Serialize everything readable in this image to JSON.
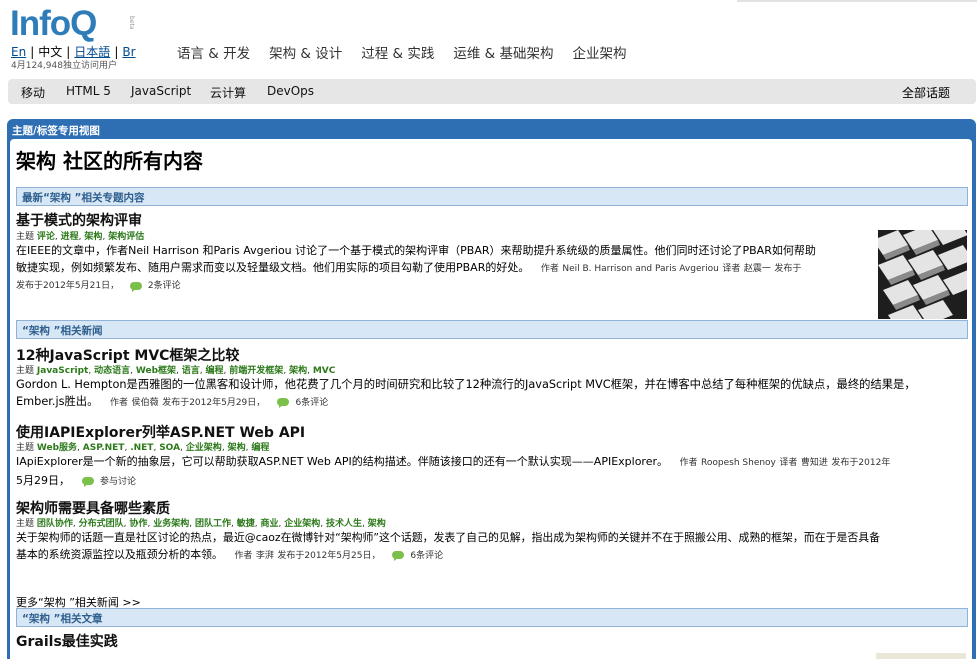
{
  "header": {
    "logo": "InfoQ",
    "logo_badge": "beta",
    "languages": [
      {
        "label": "En",
        "current": false
      },
      {
        "label": "中文",
        "current": true
      },
      {
        "label": "日本語",
        "current": false
      },
      {
        "label": "Br",
        "current": false
      }
    ],
    "visitors": "4月124,948独立访问用户",
    "main_nav": [
      "语言 & 开发",
      "架构 & 设计",
      "过程 & 实践",
      "运维 & 基础架构",
      "企业架构"
    ],
    "sub_nav": [
      "移动",
      "HTML 5",
      "JavaScript",
      "云计算",
      "DevOps"
    ],
    "all_topics": "全部话题"
  },
  "panel": {
    "title": "主题/标签专用视图",
    "page_title": "架构 社区的所有内容"
  },
  "sections": {
    "featured": "最新“架构 ”相关专题内容",
    "news": "“架构 ”相关新闻",
    "articles": "“架构 ”相关文章"
  },
  "featured_item": {
    "title": "基于模式的架构评审",
    "tag_prefix": "主题",
    "tags": [
      "评论",
      "进程",
      "架构",
      "架构评估"
    ],
    "desc_line1": "在IEEE的文章中，作者Neil Harrison 和Paris Avgeriou 讨论了一个基于模式的架构评审（PBAR）来帮助提升系统级的质量属性。他们同时还讨论了PBAR如何帮助",
    "desc_line2": "敏捷实现，例如频繁发布、随用户需求而变以及轻量级文档。他们用实际的项目勾勒了使用PBAR的好处。",
    "author_label": "作者",
    "author": "Neil B. Harrison and Paris Avgeriou",
    "translator_label": "译者",
    "translator": "赵震一",
    "published": "发布于2012年5月21日，",
    "comments": "2条评论",
    "thumb_icon": "architecture-pattern-photo"
  },
  "news": [
    {
      "title": "12种JavaScript MVC框架之比较",
      "tags": [
        "JavaScript",
        "动态语言",
        "Web框架",
        "语言",
        "编程",
        "前端开发框架",
        "架构",
        "MVC"
      ],
      "desc_line1": "Gordon L. Hempton是西雅图的一位黑客和设计师，他花费了几个月的时间研究和比较了12种流行的JavaScript MVC框架，并在博客中总结了每种框架的优缺点，最终的结果是，",
      "desc_line2": "Ember.js胜出。",
      "author": "侯伯薇",
      "published": "发布于2012年5月29日，",
      "comments": "6条评论"
    },
    {
      "title": "使用IAPIExplorer列举ASP.NET Web API",
      "tags": [
        "Web服务",
        "ASP.NET",
        ".NET",
        "SOA",
        "企业架构",
        "架构",
        "编程"
      ],
      "desc_line1": "IApiExplorer是一个新的抽象层，它可以帮助获取ASP.NET Web API的结构描述。伴随该接口的还有一个默认实现——APIExplorer。",
      "desc_line2": "5月29日，",
      "author": "Roopesh Shenoy",
      "translator": "曹知进",
      "published": "发布于2012年",
      "comments": "参与讨论"
    },
    {
      "title": "架构师需要具备哪些素质",
      "tags": [
        "团队协作",
        "分布式团队",
        "协作",
        "业务架构",
        "团队工作",
        "敏捷",
        "商业",
        "企业架构",
        "技术人生",
        "架构"
      ],
      "desc_line1": "关于架构师的话题一直是社区讨论的热点，最近@caoz在微博针对“架构师”这个话题，发表了自己的见解，指出成为架构师的关键并不在于照搬公用、成熟的框架，而在于是否具备",
      "desc_line2": "基本的系统资源监控以及瓶颈分析的本领。",
      "author": "李湃",
      "published": "发布于2012年5月25日，",
      "comments": "6条评论"
    }
  ],
  "more_news": "更多“架构 ”相关新闻 >>",
  "article": {
    "title": "Grails最佳实践"
  },
  "colors": {
    "panel_blue": "#2e6fb3",
    "tag_green": "#2d7a1b",
    "section_bg": "#d8e7f5",
    "logo_blue": "#2e7db8"
  }
}
